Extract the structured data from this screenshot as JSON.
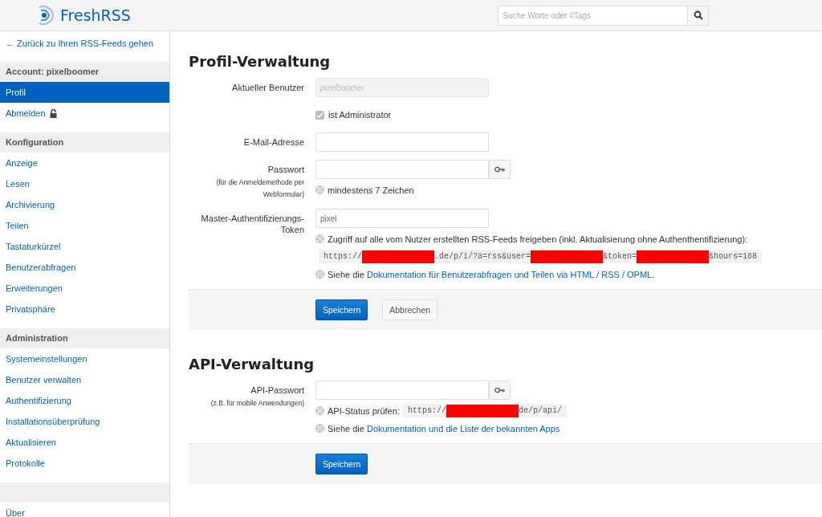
{
  "header": {
    "logo": "FreshRSS",
    "search": {
      "placeholder": "Suche Worte oder #Tags"
    }
  },
  "sidebar": {
    "back_link": "← Zurück zu Ihren RSS-Feeds gehen",
    "groups": [
      {
        "title": "Account: pixelboomer",
        "items": [
          {
            "label": "Profil",
            "selected": true,
            "kind": "link"
          },
          {
            "label": "Abmelden",
            "selected": false,
            "kind": "lock"
          }
        ]
      },
      {
        "title": "Konfiguration",
        "items": [
          {
            "label": "Anzeige",
            "selected": false,
            "kind": "link"
          },
          {
            "label": "Lesen",
            "selected": false,
            "kind": "link"
          },
          {
            "label": "Archivierung",
            "selected": false,
            "kind": "link"
          },
          {
            "label": "Teilen",
            "selected": false,
            "kind": "link"
          },
          {
            "label": "Tastaturkürzel",
            "selected": false,
            "kind": "link"
          },
          {
            "label": "Benutzerabfragen",
            "selected": false,
            "kind": "link"
          },
          {
            "label": "Erweiterungen",
            "selected": false,
            "kind": "link"
          },
          {
            "label": "Privatsphäre",
            "selected": false,
            "kind": "link"
          }
        ]
      },
      {
        "title": "Administration",
        "items": [
          {
            "label": "Systemeinstellungen",
            "selected": false,
            "kind": "link"
          },
          {
            "label": "Benutzer verwalten",
            "selected": false,
            "kind": "link"
          },
          {
            "label": "Authentifizierung",
            "selected": false,
            "kind": "link"
          },
          {
            "label": "Installationsüberprüfung",
            "selected": false,
            "kind": "link"
          },
          {
            "label": "Aktualisieren",
            "selected": false,
            "kind": "link"
          },
          {
            "label": "Protokolle",
            "selected": false,
            "kind": "link"
          }
        ]
      },
      {
        "items": [
          {
            "label": "Über",
            "selected": false,
            "kind": "link"
          }
        ]
      }
    ]
  },
  "sections": [
    {
      "title": "Profil-Verwaltung",
      "fields": [
        {
          "kind": "text",
          "label": "Aktueller Benutzer",
          "value": "pixelboomer",
          "disabled": true
        },
        {
          "kind": "checkbox",
          "label": "ist Administrator",
          "checked": true,
          "disabled": true
        },
        {
          "kind": "text",
          "label": "E-Mail-Adresse",
          "disabled": false
        },
        {
          "kind": "password",
          "label": "Passwort",
          "hint": "(für die Anmeldemethode per Webformular)",
          "notes": [
            {
              "icon": true,
              "parts": [
                {
                  "kind": "text",
                  "text": "mindestens 7 Zeichen"
                }
              ]
            }
          ]
        },
        {
          "kind": "text",
          "label": "Master-Authentifizierungs-Token",
          "value": "pixel",
          "disabled": false,
          "notes": [
            {
              "icon": true,
              "parts": [
                {
                  "kind": "text",
                  "text": "Zugriff auf alle vom Nutzer erstellten RSS-Feeds freigeben (inkl. Aktualisierung ohne Authenthentifizierung):"
                }
              ]
            },
            {
              "icon": false,
              "parts": [
                {
                  "kind": "code",
                  "segments": [
                    {
                      "kind": "text",
                      "text": "https://"
                    },
                    {
                      "kind": "redacted"
                    },
                    {
                      "kind": "text",
                      "text": ".de/p/i/?a=rss&user="
                    },
                    {
                      "kind": "redacted"
                    },
                    {
                      "kind": "text",
                      "text": "&token="
                    },
                    {
                      "kind": "redacted"
                    },
                    {
                      "kind": "text",
                      "text": "&hours=168"
                    }
                  ]
                }
              ]
            },
            {
              "icon": true,
              "parts": [
                {
                  "kind": "text",
                  "text": "Siehe die "
                },
                {
                  "kind": "link",
                  "text": "Dokumentation für Benutzerabfragen und Teilen via HTML / RSS / OPML"
                },
                {
                  "kind": "text",
                  "text": "."
                }
              ]
            }
          ]
        }
      ],
      "buttons": [
        {
          "label": "Speichern",
          "kind": "primary"
        },
        {
          "label": "Abbrechen",
          "kind": "secondary"
        }
      ]
    },
    {
      "title": "API-Verwaltung",
      "fields": [
        {
          "kind": "password",
          "label": "API-Passwort",
          "hint": "(z.B. für mobile Anwendungen)",
          "notes": [
            {
              "icon": true,
              "parts": [
                {
                  "kind": "text",
                  "text": "API-Status prüfen:"
                },
                {
                  "kind": "code",
                  "segments": [
                    {
                      "kind": "text",
                      "text": "https://"
                    },
                    {
                      "kind": "redacted"
                    },
                    {
                      "kind": "text",
                      "text": "de/p/api/"
                    }
                  ]
                }
              ]
            },
            {
              "icon": true,
              "parts": [
                {
                  "kind": "text",
                  "text": "Siehe die "
                },
                {
                  "kind": "link",
                  "text": "Dokumentation und die Liste der bekannten Apps"
                }
              ]
            }
          ]
        }
      ],
      "buttons": [
        {
          "label": "Speichern",
          "kind": "primary"
        }
      ]
    }
  ]
}
